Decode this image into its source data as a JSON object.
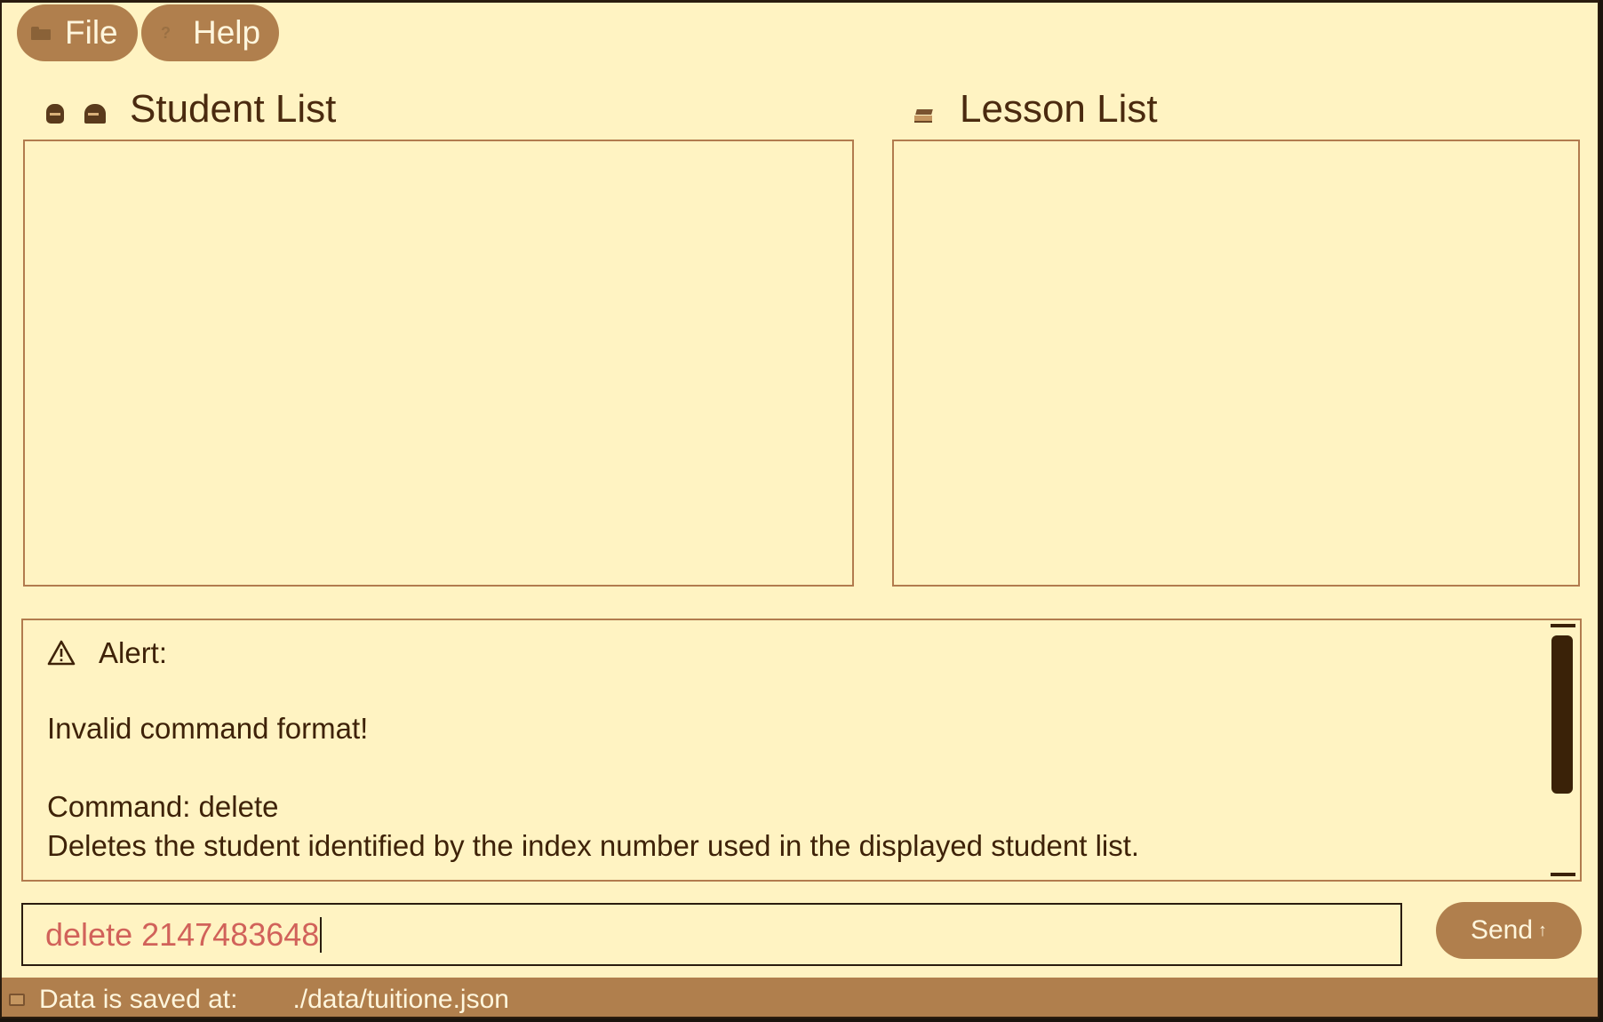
{
  "menu": {
    "file_label": "File",
    "help_label": "Help"
  },
  "student_panel": {
    "title": "Student List",
    "items": []
  },
  "lesson_panel": {
    "title": "Lesson List",
    "items": []
  },
  "result": {
    "alert_label": "Alert:",
    "line_invalid": "Invalid command format!",
    "line_command": "Command: delete",
    "line_desc": "Deletes the student identified by the index number used in the displayed student list."
  },
  "command": {
    "value": "delete 2147483648"
  },
  "send_button": {
    "label": "Send",
    "arrow": "↑"
  },
  "status": {
    "label": "Data is saved at:",
    "path": "./data/tuitione.json"
  },
  "colors": {
    "background": "#fff3c2",
    "accent": "#b07f4d",
    "text": "#4a2a0f",
    "error_text": "#d1625a"
  },
  "icons": {
    "file": "folder-icon",
    "help": "question-icon",
    "student_boy": "boy-icon",
    "student_girl": "girl-icon",
    "lesson": "book-icon",
    "alert": "warning-icon",
    "status": "storage-icon"
  }
}
